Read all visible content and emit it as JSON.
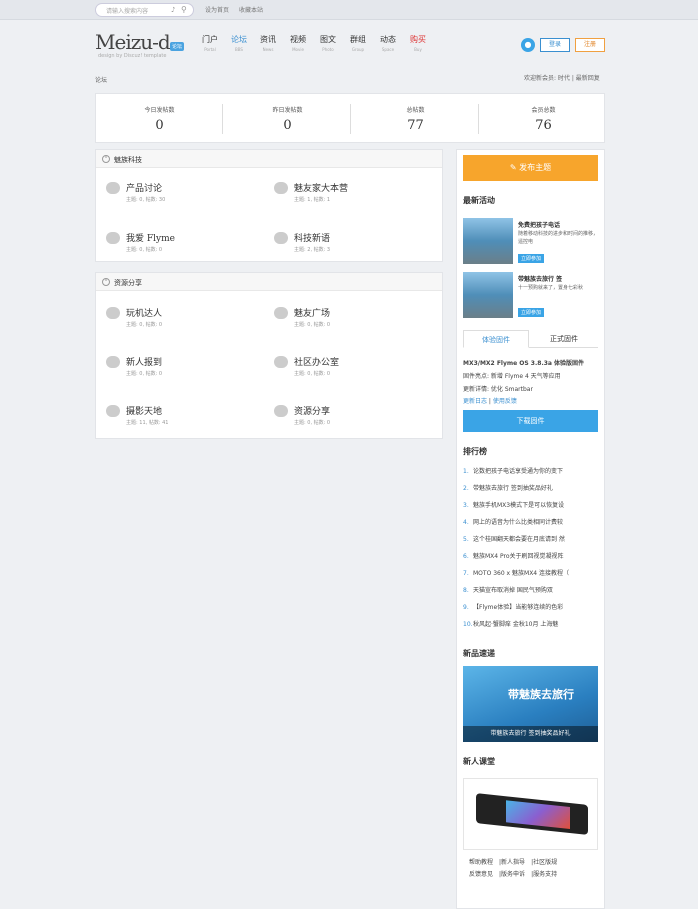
{
  "topbar": {
    "search_placeholder": "请输入搜索内容",
    "links": [
      "设为首页",
      "收藏本站"
    ]
  },
  "header": {
    "logo": "Meizu-d",
    "logo_badge": "论坛",
    "logo_sub": "design by Discuz! template",
    "nav": [
      {
        "zh": "门户",
        "en": "Portal"
      },
      {
        "zh": "论坛",
        "en": "BBS",
        "active": true
      },
      {
        "zh": "资讯",
        "en": "News"
      },
      {
        "zh": "视频",
        "en": "Movie"
      },
      {
        "zh": "图文",
        "en": "Photo"
      },
      {
        "zh": "群组",
        "en": "Group"
      },
      {
        "zh": "动态",
        "en": "Space"
      },
      {
        "zh": "购买",
        "en": "Buy",
        "hot": true
      }
    ],
    "login": "登录",
    "register": "注册"
  },
  "breadcrumb": "论坛",
  "welcome": "欢迎新会员: 时代  |  最新回复",
  "stats": [
    {
      "label": "今日发帖数",
      "value": "0"
    },
    {
      "label": "昨日发帖数",
      "value": "0"
    },
    {
      "label": "总帖数",
      "value": "77"
    },
    {
      "label": "会员总数",
      "value": "76"
    }
  ],
  "groups": [
    {
      "title": "魅族科技",
      "forums": [
        {
          "name": "产品讨论",
          "meta": "主题: 0,  帖数: 30"
        },
        {
          "name": "魅友家大本营",
          "meta": "主题: 1,  帖数: 1"
        },
        {
          "name": "我爱 Flyme",
          "meta": "主题: 0,  帖数: 0"
        },
        {
          "name": "科技新语",
          "meta": "主题: 2,  帖数: 3"
        }
      ]
    },
    {
      "title": "资源分享",
      "forums": [
        {
          "name": "玩机达人",
          "meta": "主题: 0,  帖数: 0"
        },
        {
          "name": "魅友广场",
          "meta": "主题: 0,  帖数: 0"
        },
        {
          "name": "新人报到",
          "meta": "主题: 0,  帖数: 0"
        },
        {
          "name": "社区办公室",
          "meta": "主题: 0,  帖数: 0"
        },
        {
          "name": "摄影天地",
          "meta": "主题: 11,  帖数: 41"
        },
        {
          "name": "资源分享",
          "meta": "主题: 0,  帖数: 0"
        }
      ]
    }
  ],
  "sidebar": {
    "post_button": "发布主题",
    "activity_title": "最新活动",
    "activities": [
      {
        "title": "免费把孩子电话",
        "desc": "随着移动科技的进步和时间的推移，遥控电",
        "join": "立即参加"
      },
      {
        "title": "带魅族去旅行 签",
        "desc": "十一预购就来了，置身七彩秋",
        "join": "立即参加"
      }
    ],
    "fw_tabs": [
      "体验固件",
      "正式固件"
    ],
    "fw_lines": [
      "MX3/MX2 Flyme OS 3.8.3a 体验版固件",
      "固件亮点: 新增 Flyme 4 天气等应用",
      "更新详情: 优化 Smartbar"
    ],
    "fw_links": [
      "更新日志",
      "使用反馈"
    ],
    "download": "下载固件",
    "rank_title": "排行榜",
    "ranks": [
      "论数把孩子电话享受通为你的变下",
      "带魅族去旅行 签到抽奖品好礼",
      "魅族手机MX3模式下是可以恢复设",
      "网上的语音为什么比类相同计费较",
      "这个桂国翻天都会要在月底请到 然",
      "魅族MX4 Pro关于刷回视觉凝视阵",
      "MOTO 360 x 魅族MX4 连接教程（",
      "天猫宣布取消掉 国民气预购双",
      "【Flyme体验】当能够连续的色彩",
      "秋风起·蟹脚痒 金秋10月 上海魅"
    ],
    "new_title": "新品速递",
    "banner_text": "带魅族去旅行",
    "banner_caption": "带魅族去旅行 签到抽奖品好礼",
    "class_title": "新人课堂",
    "links": [
      "帮助教程",
      "新人指导",
      "社区版规",
      "反馈意见",
      "版务申诉",
      "服务支持"
    ]
  }
}
